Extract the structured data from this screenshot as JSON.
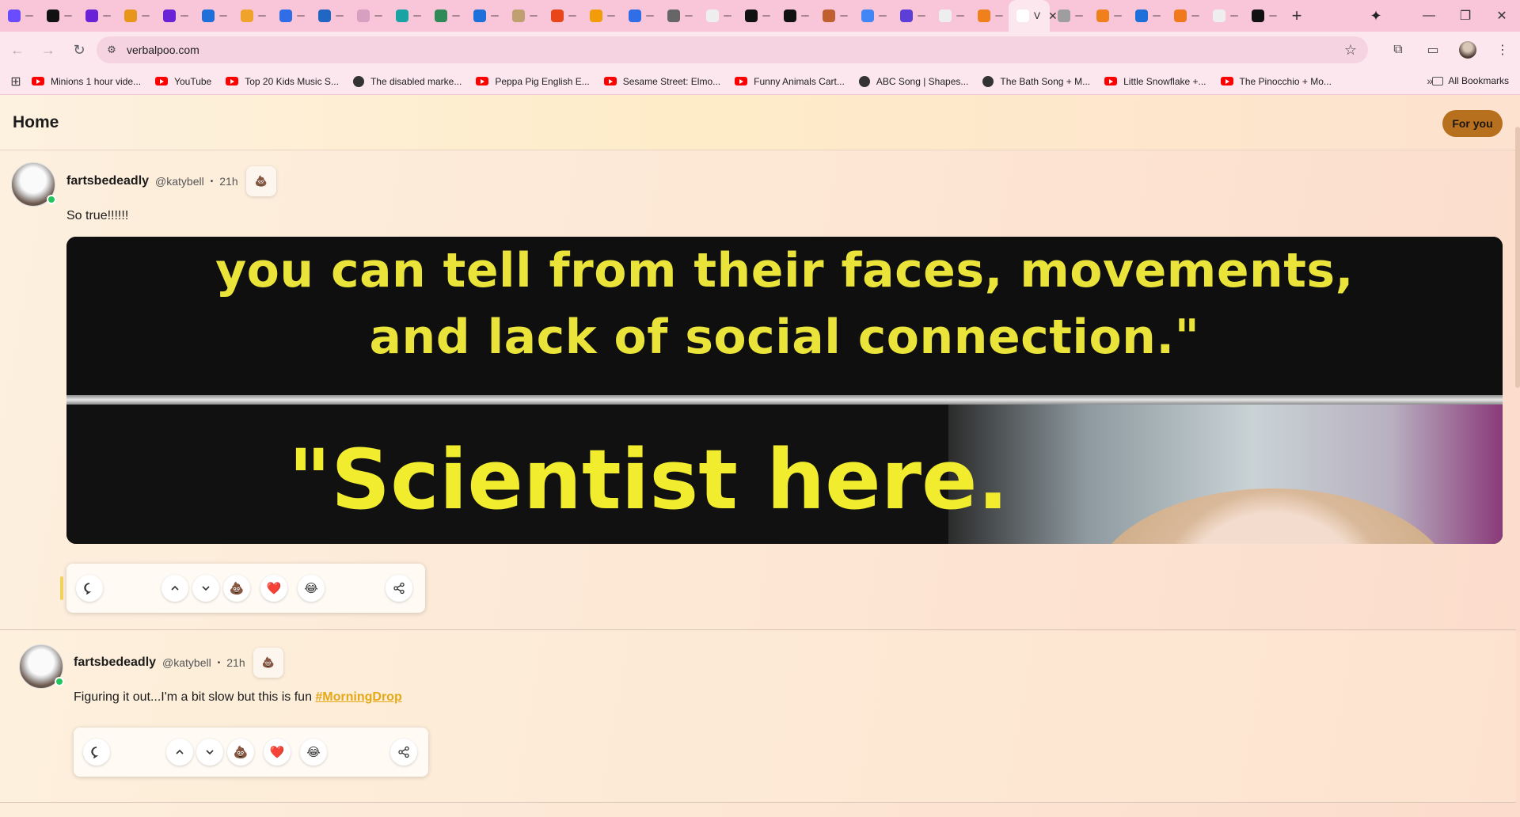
{
  "browser": {
    "tabs_count": 32,
    "active_tab_label": "V",
    "url": "verbalpoo.com",
    "tab_favicon_colors": [
      "#6a4cff",
      "#111111",
      "#6a22d6",
      "#e8961b",
      "#6a22d6",
      "#1e6fd9",
      "#f0a32b",
      "#2f6ee6",
      "#2266c4",
      "#d8a0c0",
      "#1aa3a3",
      "#2e8b57",
      "#1e6fd9",
      "#c0a070",
      "#e8451b",
      "#f29c0a",
      "#2f6ee6",
      "#666666",
      "#eeeeee",
      "#111111",
      "#111111",
      "#c06030",
      "#4285f4",
      "#5b3fd6",
      "#eeeeee",
      "#f0801b",
      "#ffffff",
      "#9e9e9e",
      "#f0801b",
      "#1e6fd9",
      "#f07a1b",
      "#eeeeee",
      "#111111"
    ]
  },
  "bookmarks": [
    {
      "label": "Minions 1 hour vide...",
      "icon": "youtube-icon"
    },
    {
      "label": "YouTube",
      "icon": "youtube-icon"
    },
    {
      "label": "Top 20 Kids Music S...",
      "icon": "youtube-icon"
    },
    {
      "label": "The disabled marke...",
      "icon": "globe-icon"
    },
    {
      "label": "Peppa Pig English E...",
      "icon": "youtube-icon"
    },
    {
      "label": "Sesame Street: Elmo...",
      "icon": "youtube-icon"
    },
    {
      "label": "Funny Animals Cart...",
      "icon": "youtube-icon"
    },
    {
      "label": "ABC Song | Shapes...",
      "icon": "globe-icon"
    },
    {
      "label": "The Bath Song + M...",
      "icon": "globe-icon"
    },
    {
      "label": "Little Snowflake +...",
      "icon": "youtube-icon"
    },
    {
      "label": "The Pinocchio + Mo...",
      "icon": "youtube-icon"
    }
  ],
  "bookmarks_all": "All Bookmarks",
  "app": {
    "title": "Home",
    "feed_toggle": "For you",
    "accent_color": "#b7701e",
    "hashtag_color": "#e6a817"
  },
  "posts": [
    {
      "username": "fartsbedeadly",
      "handle": "@katybell",
      "separator": "•",
      "time": "21h",
      "text": "So true!!!!!!",
      "image_caption_line1": "you can tell from their faces, movements,",
      "image_caption_line2": "and lack of social connection.\"",
      "image_caption_line3": "\"Scientist here."
    },
    {
      "username": "fartsbedeadly",
      "handle": "@katybell",
      "separator": "•",
      "time": "21h",
      "text": "Figuring it out...I'm a bit slow but this is fun ",
      "hashtag": "#MorningDrop"
    }
  ],
  "reactions": {
    "poop": "💩",
    "heart": "❤️",
    "laugh": "😂"
  }
}
